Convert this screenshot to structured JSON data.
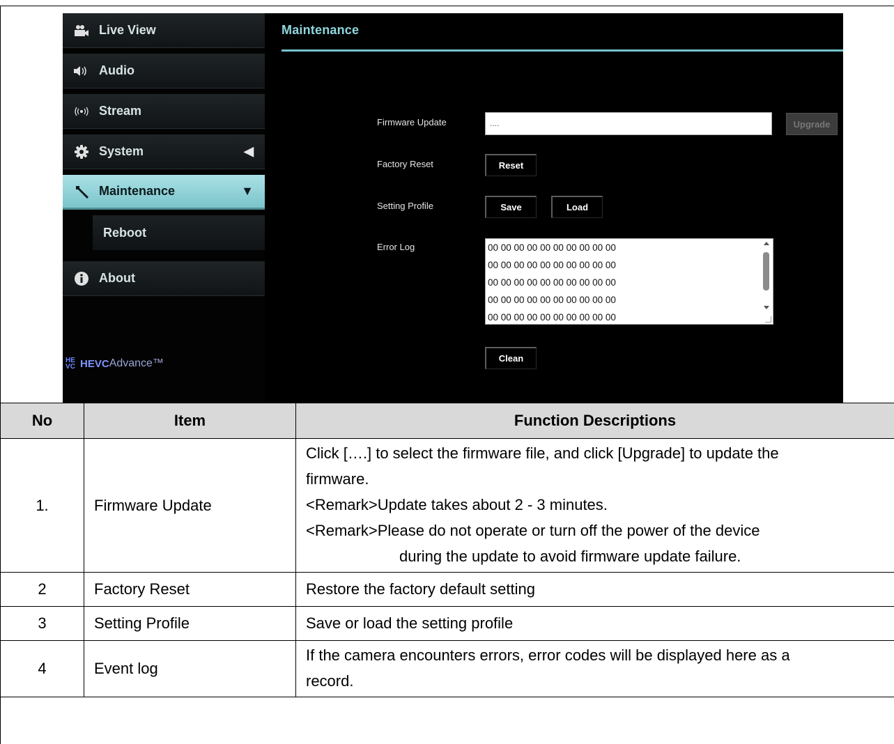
{
  "sidebar": {
    "items": [
      {
        "label": "Live View",
        "icon": "camera-icon"
      },
      {
        "label": "Audio",
        "icon": "speaker-icon"
      },
      {
        "label": "Stream",
        "icon": "broadcast-icon"
      },
      {
        "label": "System",
        "icon": "gear-icon"
      },
      {
        "label": "Maintenance",
        "icon": "wrench-icon"
      },
      {
        "label": "Reboot"
      },
      {
        "label": "About",
        "icon": "info-icon"
      }
    ],
    "logo": {
      "mark": "HE VC",
      "brand": "HEVC",
      "suffix": "Advance™"
    }
  },
  "main": {
    "title": "Maintenance",
    "firmware_label": "Firmware Update",
    "firmware_value": "....",
    "upgrade_label": "Upgrade",
    "factory_label": "Factory Reset",
    "reset_label": "Reset",
    "profile_label": "Setting Profile",
    "save_label": "Save",
    "load_label": "Load",
    "errorlog_label": "Error Log",
    "errorlog_lines": [
      "00 00 00 00 00 00 00 00 00 00",
      "00 00 00 00 00 00 00 00 00 00",
      "00 00 00 00 00 00 00 00 00 00",
      "00 00 00 00 00 00 00 00 00 00",
      "00 00 00 00 00 00 00 00 00 00"
    ],
    "clean_label": "Clean"
  },
  "table": {
    "headers": [
      "No",
      "Item",
      "Function Descriptions"
    ],
    "rows": [
      {
        "no": "1.",
        "item": "Firmware Update",
        "desc": [
          "Click [….] to select the firmware file, and click [Upgrade] to update the",
          "firmware.",
          "<Remark>Update takes about 2 - 3 minutes.",
          "<Remark>Please do not operate or turn off the power of the device",
          "during the update to avoid firmware update failure."
        ]
      },
      {
        "no": "2",
        "item": "Factory Reset",
        "desc": [
          "Restore the factory default setting"
        ]
      },
      {
        "no": "3",
        "item": "Setting Profile",
        "desc": [
          "Save or load the setting profile"
        ]
      },
      {
        "no": "4",
        "item": "Event log",
        "desc": [
          "If the camera encounters errors, error codes will be displayed here as a",
          "record."
        ]
      }
    ]
  },
  "colors": {
    "accent": "#74c3cb",
    "active_nav": "#a9e1e6",
    "panel_bg": "#000000"
  }
}
